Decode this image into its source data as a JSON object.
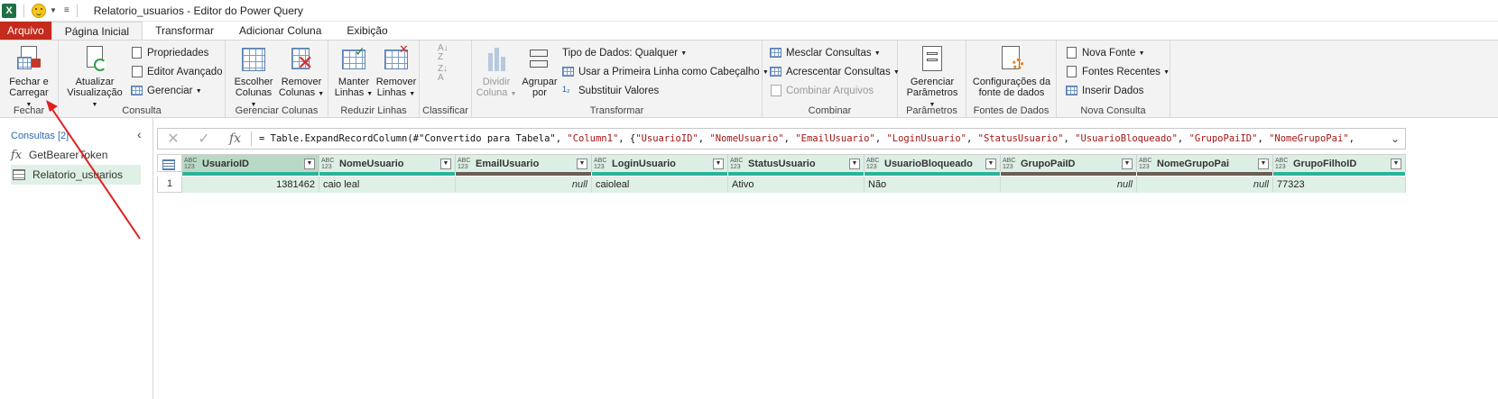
{
  "titlebar": {
    "app_icon": "X",
    "title": "Relatorio_usuarios - Editor do Power Query"
  },
  "tabs": [
    {
      "label": "Arquivo"
    },
    {
      "label": "Página Inicial"
    },
    {
      "label": "Transformar"
    },
    {
      "label": "Adicionar Coluna"
    },
    {
      "label": "Exibição"
    }
  ],
  "ribbon": {
    "fechar": {
      "group_label": "Fechar",
      "close_load_line1": "Fechar e",
      "close_load_line2": "Carregar"
    },
    "consulta": {
      "group_label": "Consulta",
      "refresh_line1": "Atualizar",
      "refresh_line2": "Visualização",
      "properties": "Propriedades",
      "advanced_editor": "Editor Avançado",
      "manage": "Gerenciar"
    },
    "gerenciar_colunas": {
      "group_label": "Gerenciar Colunas",
      "choose_line1": "Escolher",
      "choose_line2": "Colunas",
      "remove_line1": "Remover",
      "remove_line2": "Colunas"
    },
    "reduzir_linhas": {
      "group_label": "Reduzir Linhas",
      "keep_line1": "Manter",
      "keep_line2": "Linhas",
      "remove_line1": "Remover",
      "remove_line2": "Linhas"
    },
    "classificar": {
      "group_label": "Classificar"
    },
    "transformar": {
      "group_label": "Transformar",
      "split_line1": "Dividir",
      "split_line2": "Coluna",
      "group_line1": "Agrupar",
      "group_line2": "por",
      "data_type": "Tipo de Dados: Qualquer",
      "first_row_header": "Usar a Primeira Linha como Cabeçalho",
      "replace_values": "Substituir Valores"
    },
    "combinar": {
      "group_label": "Combinar",
      "merge": "Mesclar Consultas",
      "append": "Acrescentar Consultas",
      "combine_files": "Combinar Arquivos"
    },
    "parametros": {
      "group_label": "Parâmetros",
      "manage_line1": "Gerenciar",
      "manage_line2": "Parâmetros"
    },
    "fontes": {
      "group_label": "Fontes de Dados",
      "settings_line1": "Configurações da",
      "settings_line2": "fonte de dados"
    },
    "nova_consulta": {
      "group_label": "Nova Consulta",
      "new_source": "Nova Fonte",
      "recent_sources": "Fontes Recentes",
      "enter_data": "Inserir Dados"
    }
  },
  "queries_pane": {
    "title": "Consultas [2]",
    "items": [
      {
        "label": "GetBearerToken"
      },
      {
        "label": "Relatorio_usuarios"
      }
    ]
  },
  "formula_bar": {
    "fx": "fx",
    "prefix": "= Table.ExpandRecordColumn(#\"Convertido para Tabela\", ",
    "s1": "\"Column1\"",
    "mid": ", {",
    "s2": "\"UsuarioID\"",
    "s3": "\"NomeUsuario\"",
    "s4": "\"EmailUsuario\"",
    "s5": "\"LoginUsuario\"",
    "s6": "\"StatusUsuario\"",
    "s7": "\"UsuarioBloqueado\"",
    "s8": "\"GrupoPaiID\"",
    "s9": "\"NomeGrupoPai\"",
    "comma": ", "
  },
  "grid": {
    "type_label_top": "ABC",
    "type_label_bottom": "123",
    "columns": [
      {
        "name": "UsuarioID"
      },
      {
        "name": "NomeUsuario"
      },
      {
        "name": "EmailUsuario"
      },
      {
        "name": "LoginUsuario"
      },
      {
        "name": "StatusUsuario"
      },
      {
        "name": "UsuarioBloqueado"
      },
      {
        "name": "GrupoPaiID"
      },
      {
        "name": "NomeGrupoPai"
      },
      {
        "name": "GrupoFilhoID"
      }
    ],
    "rows": [
      {
        "num": "1",
        "cells": [
          "1381462",
          "caio leal",
          "null",
          "caioleal",
          "Ativo",
          "Não",
          "null",
          "null",
          "77323"
        ]
      }
    ]
  },
  "colors": {
    "file_tab": "#c42b1c",
    "valid_bar": "#2bb39a",
    "empty_bar": "#6b5d55",
    "annotation": "#e02020"
  }
}
